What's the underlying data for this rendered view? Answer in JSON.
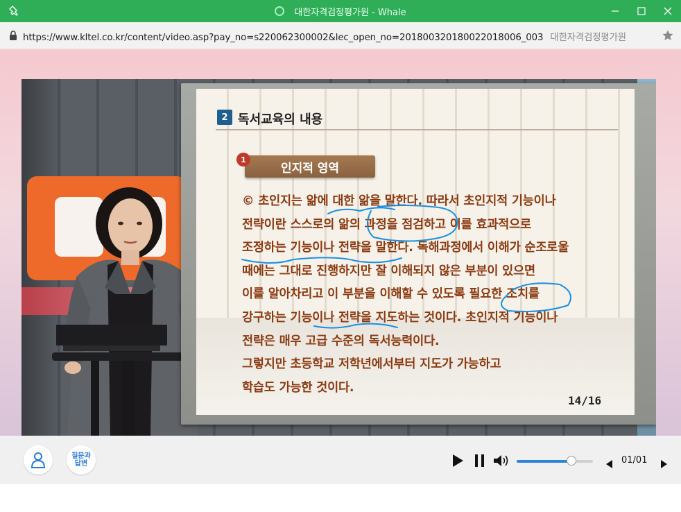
{
  "window": {
    "title": "대한자격검정평가원 - Whale",
    "accent_color": "#2fae57",
    "buttons": [
      "minimize",
      "maximize",
      "close"
    ]
  },
  "address_bar": {
    "url": "https://www.kltel.co.kr/content/video.asp?pay_no=s220062300002&lec_open_no=20180032018002201800​6_003",
    "site_name": "대한자격검정평가원"
  },
  "slide": {
    "badge": "2",
    "heading": "독서교육의 내용",
    "section_number": "1",
    "section_title": "인지적 영역",
    "lines": [
      "© 초인지는 앎에 대한 앎을 말한다. 따라서 초인지적 기능이나",
      "전략이란 스스로의 앎의 과정을 점검하고 이를 효과적으로",
      "조정하는 기능이나 전략을 말한다. 독해과정에서 이해가 순조로울",
      "때에는 그대로 진행하지만 잘 이해되지 않은 부분이 있으면",
      "이를 알아차리고 이 부분을 이해할 수 있도록 필요한 조치를",
      "강구하는 기능이나 전략을 지도하는 것이다. 초인지적 기능이나",
      "전략은 매우 고급 수준의 독서능력이다.",
      "그렇지만 초등학교 저학년에서부터 지도가 가능하고",
      "학습도 가능한 것이다."
    ],
    "page_indicator": "14/16",
    "text_color": "#8a3a10",
    "annotation_color": "#1a8fe0"
  },
  "controls": {
    "profile_icon": "person-icon",
    "qa_label": "질문과\n답변",
    "qa_line1": "질문과",
    "qa_line2": "답변",
    "volume_level": 0.72,
    "page_counter": "01/01",
    "slider_color": "#2d84d8"
  }
}
